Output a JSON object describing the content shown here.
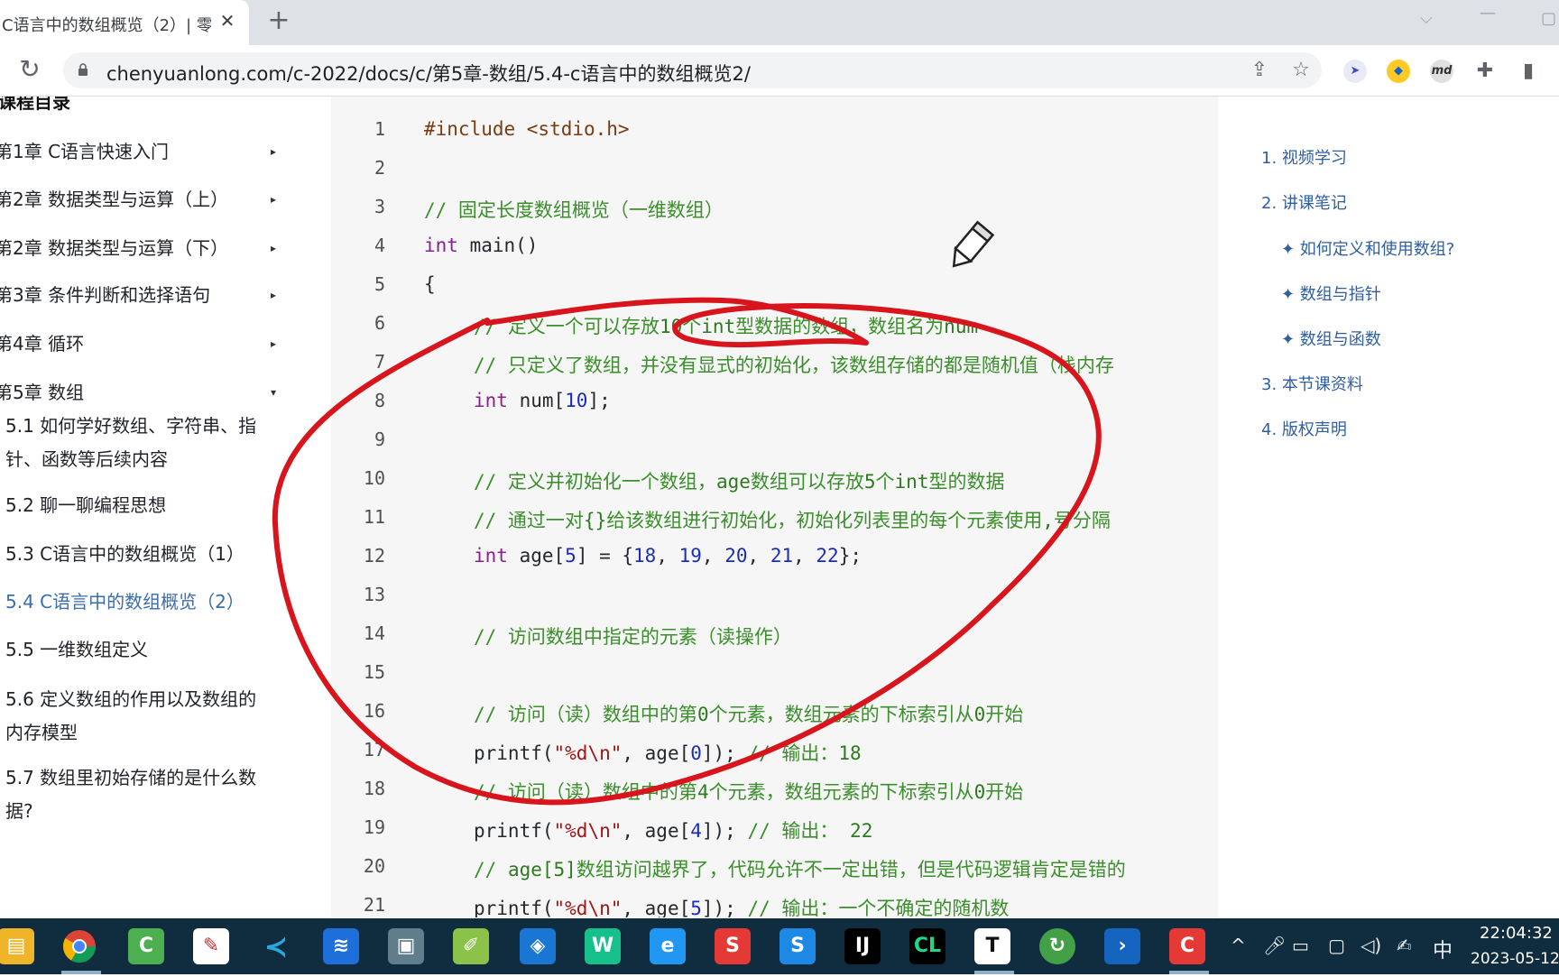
{
  "browser": {
    "tab_title": "C语言中的数组概览（2）| 零",
    "tab_close": "✕",
    "new_tab": "+",
    "url": "chenyuanlong.com/c-2022/docs/c/第5章-数组/5.4-c语言中的数组概览2/",
    "extension_md": "md"
  },
  "sidebar": {
    "heading": "课程目录",
    "chapters": [
      {
        "label": "第1章 C语言快速入门",
        "arrow": "▸"
      },
      {
        "label": "第2章 数据类型与运算（上）",
        "arrow": "▸"
      },
      {
        "label": "第2章 数据类型与运算（下）",
        "arrow": "▸"
      },
      {
        "label": "第3章 条件判断和选择语句",
        "arrow": "▸"
      },
      {
        "label": "第4章 循环",
        "arrow": "▸"
      },
      {
        "label": "第5章 数组",
        "arrow": "▾"
      }
    ],
    "sections": [
      {
        "line1": "5.1 如何学好数组、字符串、指",
        "line2": "针、函数等后续内容"
      },
      {
        "line1": "5.2 聊一聊编程思想"
      },
      {
        "line1": "5.3 C语言中的数组概览（1）"
      },
      {
        "line1": "5.4 C语言中的数组概览（2）",
        "active": true
      },
      {
        "line1": "5.5 一维数组定义"
      },
      {
        "line1": "5.6 定义数组的作用以及数组的",
        "line2": "内存模型"
      },
      {
        "line1": "5.7 数组里初始存储的是什么数",
        "line2": "据?"
      }
    ]
  },
  "code": {
    "line_numbers": [
      "1",
      "2",
      "3",
      "4",
      "5",
      "6",
      "7",
      "8",
      "9",
      "10",
      "11",
      "12",
      "13",
      "14",
      "15",
      "16",
      "17",
      "18",
      "19",
      "20",
      "21"
    ],
    "l1": "#include <stdio.h>",
    "l3": "// 固定长度数组概览（一维数组）",
    "l4_kw": "int",
    "l4_rest": " main()",
    "l5": "{",
    "l6_a": "// 定义一个可以存放",
    "l6_b": "10",
    "l6_c": "个",
    "l6_d": "int",
    "l6_e": "型数据的数组，数组名为",
    "l6_f": "num",
    "l7": "// 只定义了数组，并没有显式的初始化，该数组存储的都是随机值（栈内存",
    "l8_kw": "int",
    "l8_a": " num[",
    "l8_n": "10",
    "l8_b": "];",
    "l10_a": "// 定义并初始化一个数组，",
    "l10_b": "age",
    "l10_c": "数组可以存放",
    "l10_d": "5",
    "l10_e": "个",
    "l10_f": "int",
    "l10_g": "型的数据",
    "l11_a": "// 通过一对",
    "l11_b": "{}",
    "l11_c": "给该数组进行初始化，初始化列表里的每个元素使用",
    "l11_d": ",",
    "l11_e": "号分隔",
    "l12_kw": "int",
    "l12_a": " age[",
    "l12_n0": "5",
    "l12_b": "] = {",
    "l12_n1": "18",
    "l12_n2": "19",
    "l12_n3": "20",
    "l12_n4": "21",
    "l12_n5": "22",
    "l12_c": "};",
    "l14": "// 访问数组中指定的元素（读操作）",
    "l16_a": "// 访问（读）数组中的第",
    "l16_b": "0",
    "l16_c": "个元素，数组元素的下标索引从",
    "l16_d": "0",
    "l16_e": "开始",
    "l17_a": "printf(",
    "l17_s": "\"%d\\n\"",
    "l17_b": ", age[",
    "l17_n": "0",
    "l17_c": "]); ",
    "l17_cm": "// 输出：",
    "l17_v": "18",
    "l18_a": "// 访问（读）数组中的第",
    "l18_b": "4",
    "l18_c": "个元素，数组元素的下标索引从",
    "l18_d": "0",
    "l18_e": "开始",
    "l19_a": "printf(",
    "l19_s": "\"%d\\n\"",
    "l19_b": ", age[",
    "l19_n": "4",
    "l19_c": "]); ",
    "l19_cm": "// 输出： ",
    "l19_v": "22",
    "l20_a": "// ",
    "l20_b": "age[5]",
    "l20_c": "数组访问越界了，代码允许不一定出错，但是代码逻辑肯定是错的",
    "l21_a": "printf(",
    "l21_s": "\"%d\\n\"",
    "l21_b": ", age[",
    "l21_n": "5",
    "l21_c": "]); ",
    "l21_cm": "// 输出：一个不确定的随机数"
  },
  "toc": {
    "items": [
      "1. 视频学习",
      "2. 讲课笔记",
      "✦ 如何定义和使用数组?",
      "✦ 数组与指针",
      "✦ 数组与函数",
      "3. 本节课资料",
      "4. 版权声明"
    ]
  },
  "taskbar": {
    "time": "22:04:32",
    "date": "2023-05-12",
    "ime": "中",
    "app_labels": {
      "intellij": "IJ",
      "clion": "CL",
      "typora": "T"
    }
  },
  "colors": {
    "annotation": "#d8141c",
    "active_link": "#3a6cb0",
    "comment": "#3a8f2a",
    "keyword": "#8b1f8f",
    "number": "#1b2db8",
    "taskbar": "#0f2d3e"
  }
}
